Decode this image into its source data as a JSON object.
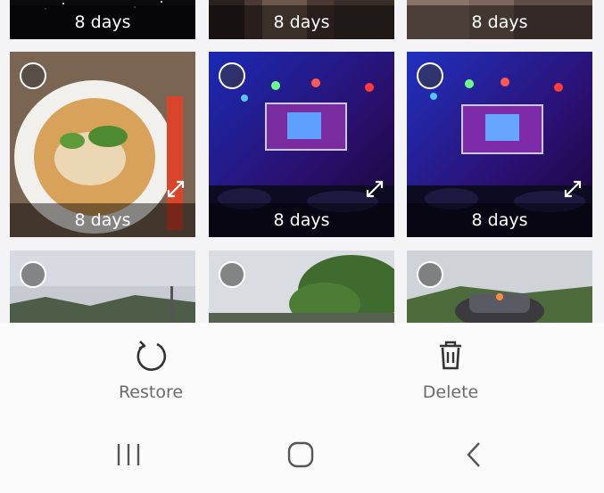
{
  "tiles": [
    {
      "label": "8 days"
    },
    {
      "label": "8 days"
    },
    {
      "label": "8 days"
    },
    {
      "label": "8 days"
    },
    {
      "label": "8 days"
    },
    {
      "label": "8 days"
    }
  ],
  "actions": {
    "restore_label": "Restore",
    "delete_label": "Delete"
  },
  "icons": {
    "restore": "restore-icon",
    "delete": "trash-icon",
    "recents": "recents-icon",
    "home": "home-icon",
    "back": "back-icon",
    "expand": "expand-icon"
  },
  "colors": {
    "background": "#f4f4f6",
    "label_overlay": "#000000",
    "action_text": "#6a6a6a"
  }
}
